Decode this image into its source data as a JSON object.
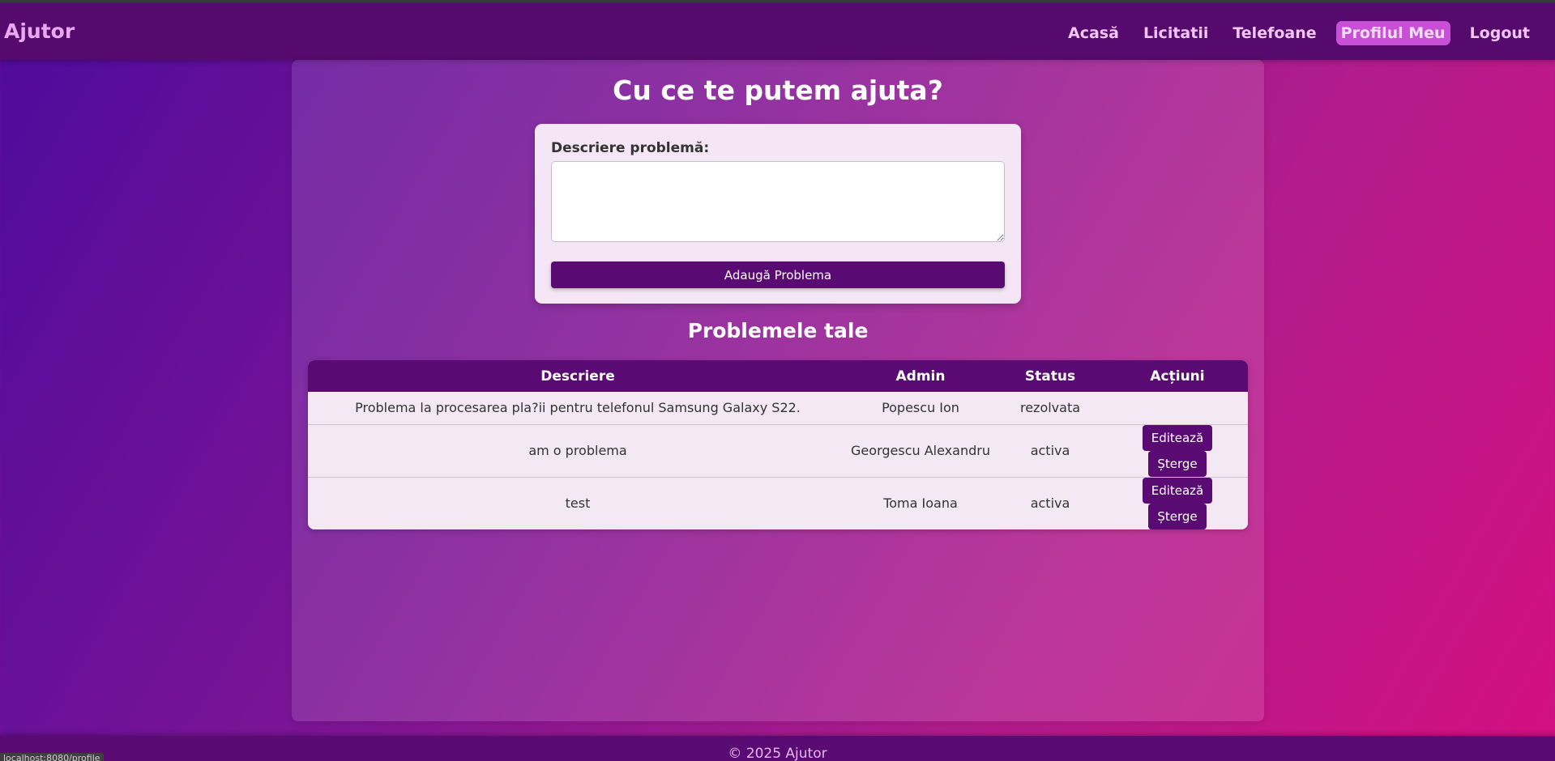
{
  "nav": {
    "brand": "Ajutor",
    "links": [
      {
        "label": "Acasă"
      },
      {
        "label": "Licitatii"
      },
      {
        "label": "Telefoane"
      },
      {
        "label": "Profilul Meu",
        "active": true
      },
      {
        "label": "Logout"
      }
    ]
  },
  "page": {
    "title": "Cu ce te putem ajuta?"
  },
  "form": {
    "label": "Descriere problemă:",
    "textarea_value": "",
    "submit_label": "Adaugă Problema"
  },
  "problems": {
    "title": "Problemele tale",
    "columns": [
      "Descriere",
      "Admin",
      "Status",
      "Acțiuni"
    ],
    "rows": [
      {
        "descriere": "Problema la procesarea pla?ii pentru telefonul Samsung Galaxy S22.",
        "admin": "Popescu Ion",
        "status": "rezolvata"
      },
      {
        "descriere": "am o problema",
        "admin": "Georgescu Alexandru",
        "status": "activa",
        "edit_label": "Editează",
        "delete_label": "Șterge"
      },
      {
        "descriere": "test",
        "admin": "Toma Ioana",
        "status": "activa",
        "edit_label": "Editează",
        "delete_label": "Șterge"
      }
    ]
  },
  "footer": {
    "text": "© 2025 Ajutor"
  },
  "status_bar": {
    "url": "localhost:8080/profile"
  },
  "colors": {
    "navbar": "#560a6e",
    "accent": "#5a0a73",
    "active_nav": "#c94fd6",
    "card": "#f4e6f5"
  }
}
